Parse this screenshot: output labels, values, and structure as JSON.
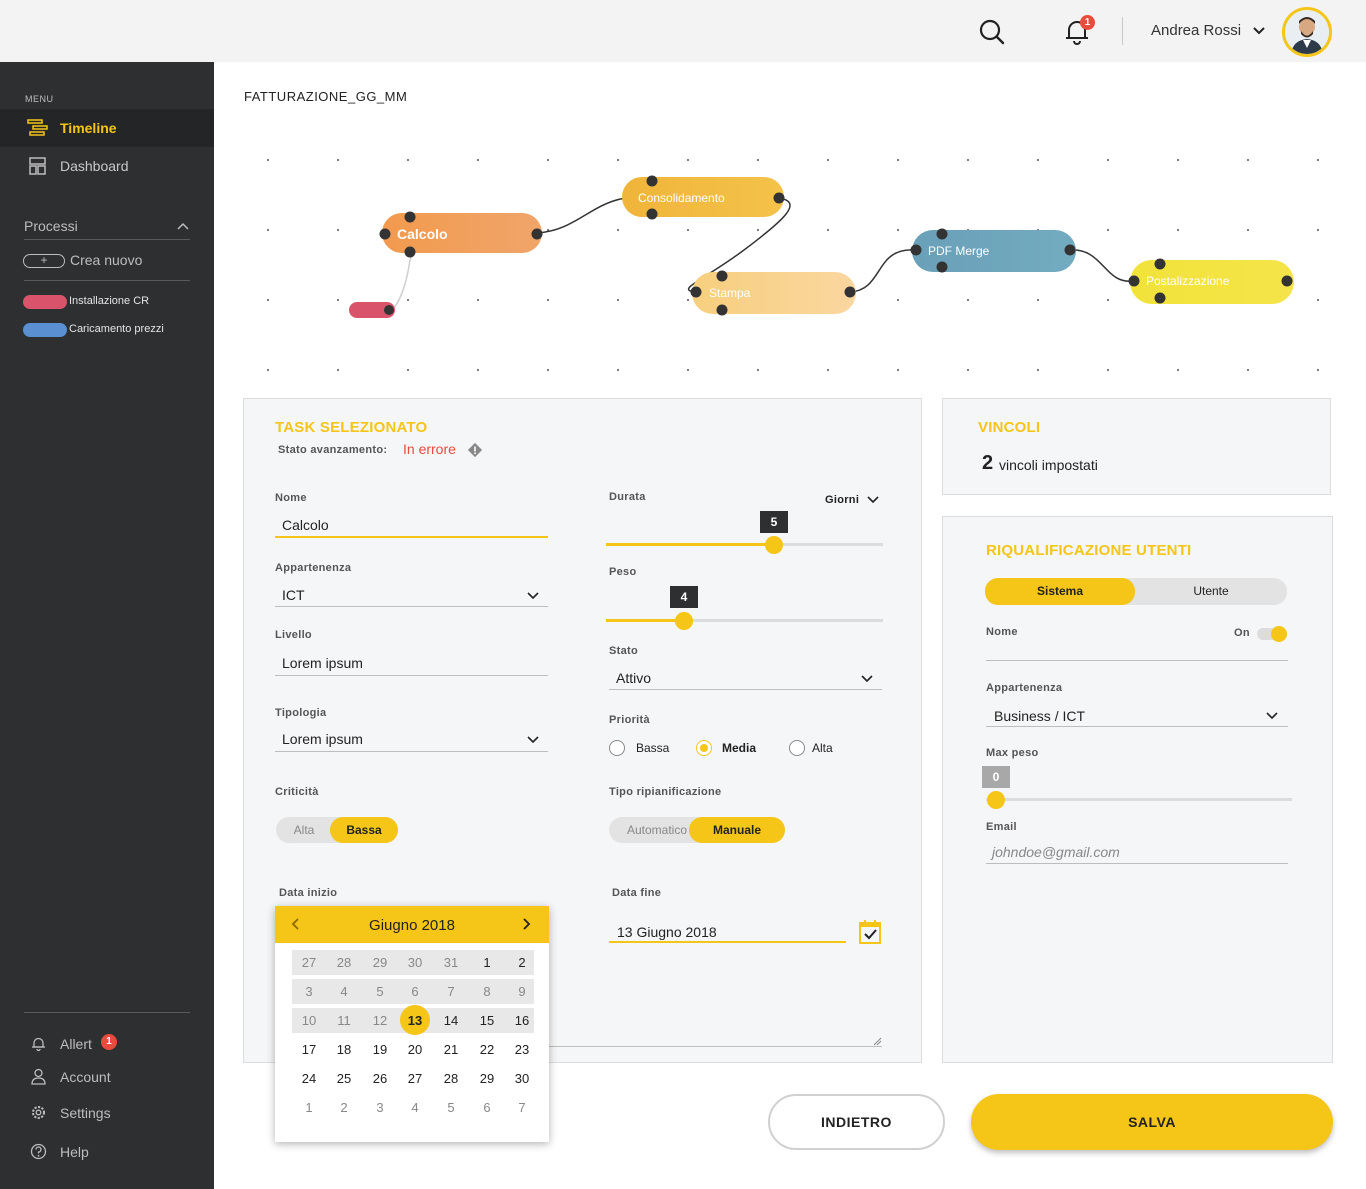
{
  "topbar": {
    "user_name": "Andrea Rossi",
    "notifications_count": "1",
    "icons": [
      "search-icon",
      "bell-icon",
      "chevron-down-icon",
      "avatar"
    ]
  },
  "sidebar": {
    "menu_label": "MENU",
    "nav": [
      {
        "label": "Timeline",
        "icon": "timeline-icon",
        "active": true
      },
      {
        "label": "Dashboard",
        "icon": "dashboard-icon",
        "active": false
      }
    ],
    "processi_label": "Processi",
    "crea_nuovo": "Crea nuovo",
    "crea_symbol": "+",
    "processes": [
      {
        "label": "Installazione CR",
        "color": "#d9546b"
      },
      {
        "label": "Caricamento prezzi",
        "color": "#5a8fd1"
      }
    ],
    "bottom": [
      {
        "label": "Allert",
        "icon": "bell-icon",
        "badge": "1"
      },
      {
        "label": "Account",
        "icon": "user-icon"
      },
      {
        "label": "Settings",
        "icon": "gear-icon"
      },
      {
        "label": "Help",
        "icon": "help-icon"
      }
    ]
  },
  "page": {
    "title": "FATTURAZIONE_GG_MM"
  },
  "flow": {
    "nodes": [
      {
        "label": "Calcolo",
        "color": "#f0944a"
      },
      {
        "label": "Consolidamento",
        "color": "#f0b53a"
      },
      {
        "label": "Stampa",
        "color": "#f9d48a"
      },
      {
        "label": "PDF Merge",
        "color": "#6ba5b8"
      },
      {
        "label": "Postalizzazione",
        "color": "#f2e33a"
      }
    ]
  },
  "task": {
    "title": "TASK SELEZIONATO",
    "stato_label": "Stato avanzamento:",
    "stato_value": "In errore",
    "stato_color": "#e94b3c",
    "nome_label": "Nome",
    "nome_value": "Calcolo",
    "appartenenza_label": "Appartenenza",
    "appartenenza_value": "ICT",
    "livello_label": "Livello",
    "livello_value": "Lorem ipsum",
    "tipologia_label": "Tipologia",
    "tipologia_value": "Lorem ipsum",
    "criticita_label": "Criticità",
    "criticita_options": [
      "Alta",
      "Bassa"
    ],
    "criticita_selected": "Bassa",
    "durata_label": "Durata",
    "durata_unit": "Giorni",
    "durata_value": "5",
    "durata_fraction": 0.6,
    "peso_label": "Peso",
    "peso_value": "4",
    "peso_fraction": 0.28,
    "stato_field_label": "Stato",
    "stato_field_value": "Attivo",
    "priorita_label": "Priorità",
    "priorita_options": [
      "Bassa",
      "Media",
      "Alta"
    ],
    "priorita_selected": "Media",
    "tipo_ripianificazione_label": "Tipo ripianificazione",
    "tipo_options": [
      "Automatico",
      "Manuale"
    ],
    "tipo_selected": "Manuale",
    "data_inizio_label": "Data inizio",
    "data_fine_label": "Data fine",
    "data_fine_value": "13 Giugno 2018"
  },
  "calendar": {
    "month": "Giugno 2018",
    "rows": [
      [
        "27",
        "28",
        "29",
        "30",
        "31",
        "1",
        "2"
      ],
      [
        "3",
        "4",
        "5",
        "6",
        "7",
        "8",
        "9"
      ],
      [
        "10",
        "11",
        "12",
        "13",
        "14",
        "15",
        "16"
      ],
      [
        "17",
        "18",
        "19",
        "20",
        "21",
        "22",
        "23"
      ],
      [
        "24",
        "25",
        "26",
        "27",
        "28",
        "29",
        "30"
      ],
      [
        "1",
        "2",
        "3",
        "4",
        "5",
        "6",
        "7"
      ]
    ],
    "selected": "13"
  },
  "vincoli": {
    "title": "VINCOLI",
    "count": "2",
    "text": "vincoli impostati"
  },
  "riqualificazione": {
    "title": "RIQUALIFICAZIONE UTENTI",
    "toggle_options": [
      "Sistema",
      "Utente"
    ],
    "toggle_selected": "Sistema",
    "nome_label": "Nome",
    "on_label": "On",
    "appartenenza_label": "Appartenenza",
    "appartenenza_value": "Business / ICT",
    "max_peso_label": "Max peso",
    "max_peso_value": "0",
    "email_label": "Email",
    "email_placeholder": "johndoe@gmail.com"
  },
  "actions": {
    "back": "INDIETRO",
    "save": "SALVA"
  }
}
